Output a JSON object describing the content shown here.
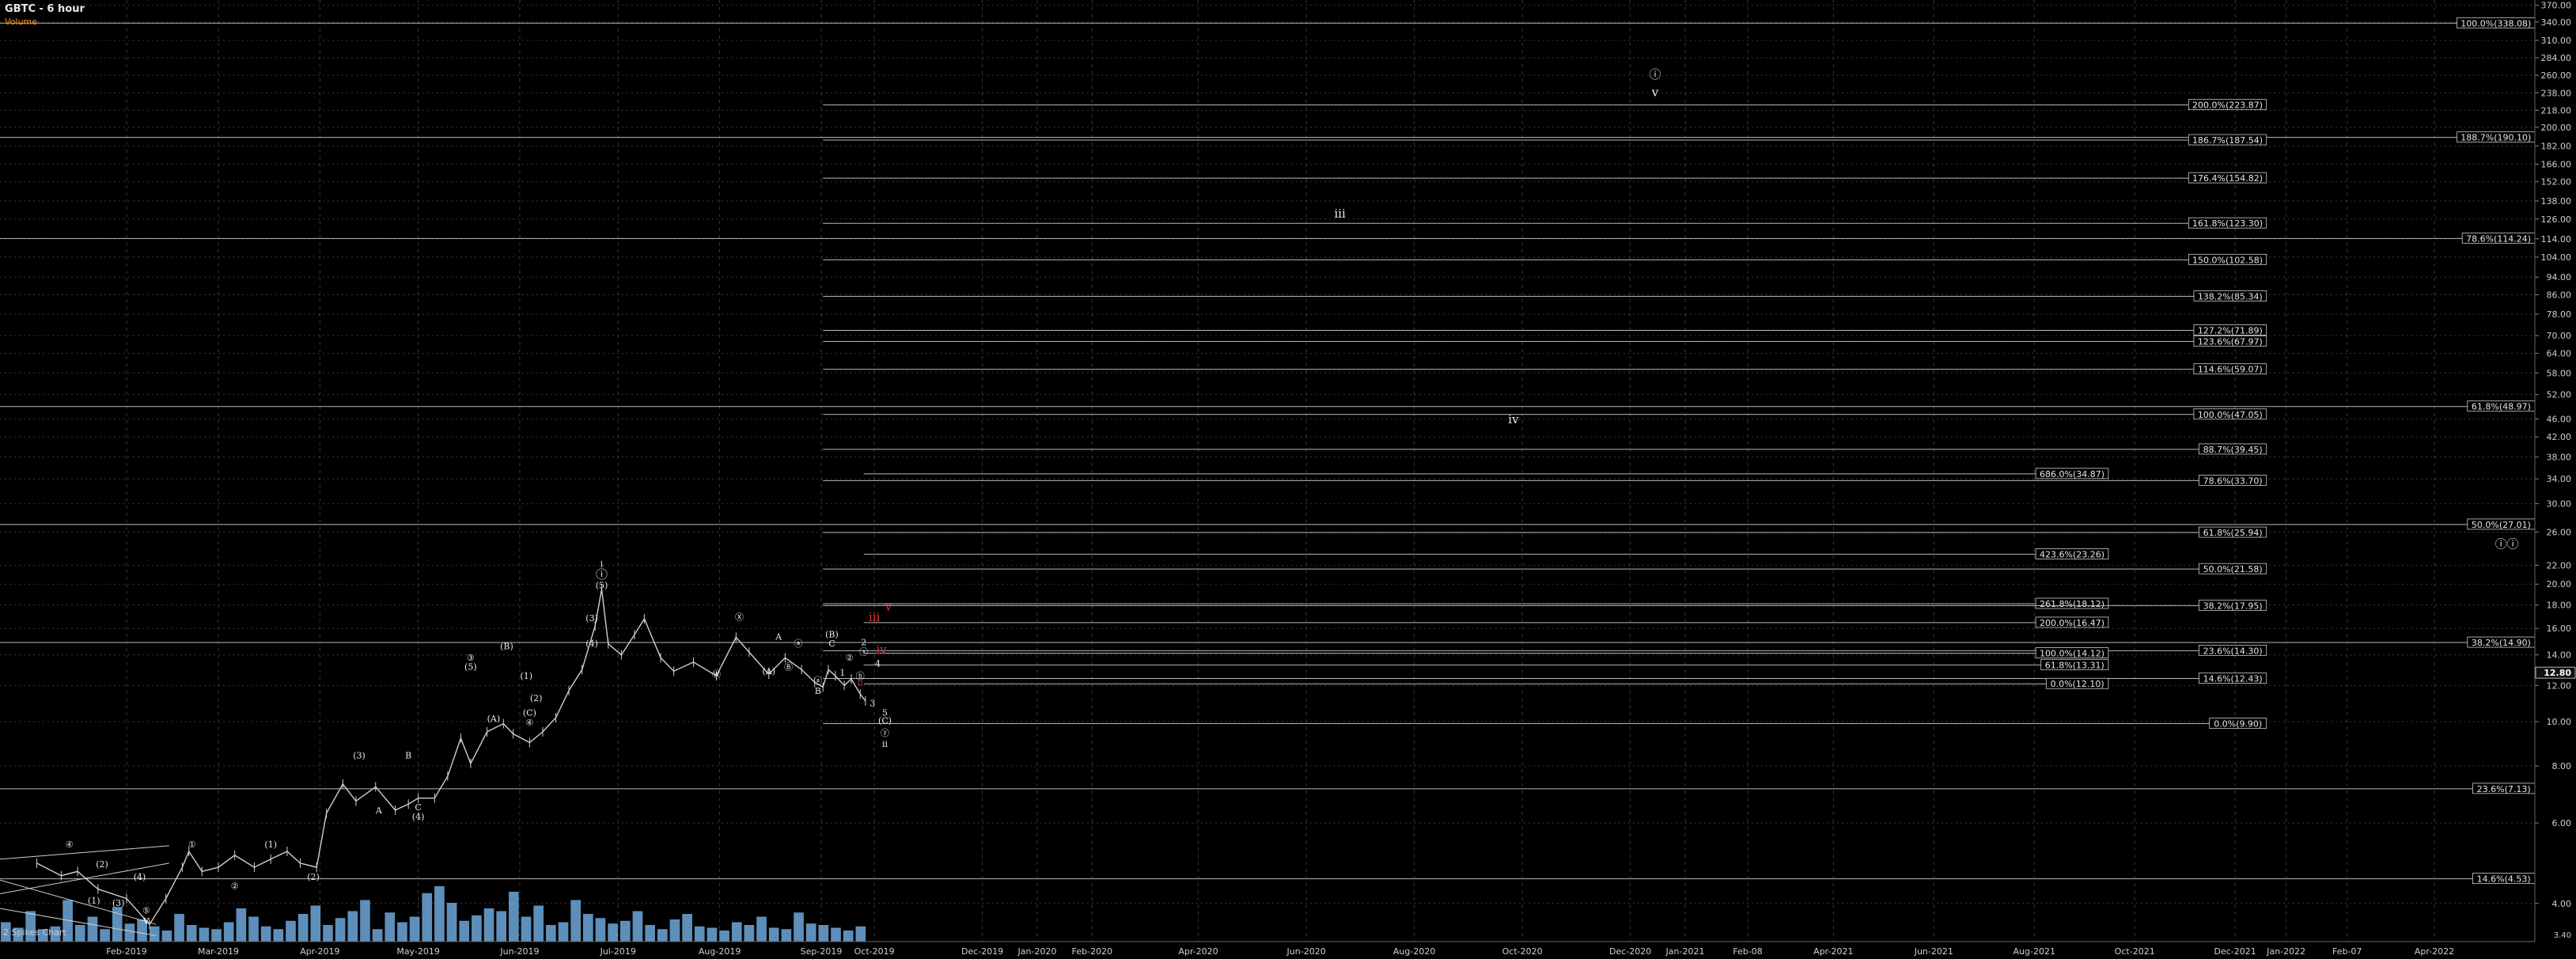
{
  "header": {
    "symbol": "GBTC - 6 hour",
    "volume_label": "Volume",
    "bottom_left": "2 Spikes Chart"
  },
  "colors": {
    "background": "#000000",
    "grid": "#3a3a3a",
    "fib": "#b8b8b8",
    "price_up": "#cfcfcf",
    "volume": "#6fa8dc",
    "red": "#e03030"
  },
  "chart_data": {
    "type": "line",
    "title": "GBTC - 6 hour",
    "y_scale": "log",
    "ylim": [
      3.3,
      380
    ],
    "grid": true,
    "y_ticks": [
      "370.00",
      "340.00",
      "310.00",
      "284.00",
      "260.00",
      "238.00",
      "218.00",
      "200.00",
      "182.00",
      "166.00",
      "152.00",
      "138.00",
      "126.00",
      "114.00",
      "104.00",
      "94.00",
      "86.00",
      "78.00",
      "70.00",
      "64.00",
      "58.00",
      "52.00",
      "46.00",
      "42.00",
      "38.00",
      "34.00",
      "30.00",
      "26.00",
      "22.00",
      "20.00",
      "18.00",
      "16.00",
      "14.00",
      "12.00",
      "10.00",
      "8.00",
      "6.00",
      "4.00"
    ],
    "x_ticks": [
      "Feb-2019",
      "Mar-2019",
      "Apr-2019",
      "May-2019",
      "Jun-2019",
      "Jul-2019",
      "Aug-2019",
      "Sep-2019",
      "Oct-2019",
      "Dec-2019",
      "Jan-2020",
      "Feb-2020",
      "Apr-2020",
      "Jun-2020",
      "Aug-2020",
      "Oct-2020",
      "Dec-2020",
      "Jan-2021",
      "Feb-08",
      "Apr-2021",
      "Jun-2021",
      "Aug-2021",
      "Oct-2021",
      "Dec-2021",
      "Jan-2022",
      "Feb-07",
      "Apr-2022"
    ],
    "current_price": "12.80",
    "bottom_right_label": "3.40",
    "series": [
      {
        "values": [
          [
            "2019-01-10",
            4.9
          ],
          [
            "2019-01-16",
            4.6
          ],
          [
            "2019-01-20",
            4.7
          ],
          [
            "2019-01-25",
            4.3
          ],
          [
            "2019-02-01",
            4.1
          ],
          [
            "2019-02-08",
            3.6
          ],
          [
            "2019-02-13",
            4.1
          ],
          [
            "2019-02-18",
            4.8
          ],
          [
            "2019-02-20",
            5.2
          ],
          [
            "2019-02-24",
            4.7
          ],
          [
            "2019-03-01",
            4.8
          ],
          [
            "2019-03-06",
            5.1
          ],
          [
            "2019-03-12",
            4.8
          ],
          [
            "2019-03-17",
            5.0
          ],
          [
            "2019-03-22",
            5.2
          ],
          [
            "2019-03-26",
            4.9
          ],
          [
            "2019-03-31",
            4.8
          ],
          [
            "2019-04-03",
            6.3
          ],
          [
            "2019-04-08",
            7.3
          ],
          [
            "2019-04-12",
            6.7
          ],
          [
            "2019-04-18",
            7.2
          ],
          [
            "2019-04-24",
            6.4
          ],
          [
            "2019-04-28",
            6.6
          ],
          [
            "2019-05-01",
            6.8
          ],
          [
            "2019-05-06",
            6.8
          ],
          [
            "2019-05-10",
            7.6
          ],
          [
            "2019-05-14",
            9.2
          ],
          [
            "2019-05-17",
            8.1
          ],
          [
            "2019-05-22",
            9.5
          ],
          [
            "2019-05-27",
            9.9
          ],
          [
            "2019-05-30",
            9.4
          ],
          [
            "2019-06-04",
            9.0
          ],
          [
            "2019-06-08",
            9.5
          ],
          [
            "2019-06-12",
            10.2
          ],
          [
            "2019-06-16",
            11.7
          ],
          [
            "2019-06-20",
            13.0
          ],
          [
            "2019-06-24",
            16.2
          ],
          [
            "2019-06-26",
            19.5
          ],
          [
            "2019-06-28",
            14.8
          ],
          [
            "2019-07-02",
            14.0
          ],
          [
            "2019-07-06",
            15.5
          ],
          [
            "2019-07-09",
            16.8
          ],
          [
            "2019-07-14",
            13.8
          ],
          [
            "2019-07-18",
            12.9
          ],
          [
            "2019-07-24",
            13.5
          ],
          [
            "2019-07-31",
            12.6
          ],
          [
            "2019-08-06",
            15.3
          ],
          [
            "2019-08-10",
            14.2
          ],
          [
            "2019-08-16",
            12.7
          ],
          [
            "2019-08-21",
            13.8
          ],
          [
            "2019-08-26",
            13.0
          ],
          [
            "2019-08-30",
            12.2
          ],
          [
            "2019-09-02",
            11.9
          ],
          [
            "2019-09-05",
            13.0
          ],
          [
            "2019-09-09",
            12.6
          ],
          [
            "2019-09-14",
            12.0
          ],
          [
            "2019-09-18",
            12.4
          ],
          [
            "2019-09-23",
            11.5
          ],
          [
            "2019-09-26",
            11.1
          ]
        ]
      }
    ],
    "volume": [
      14,
      10,
      22,
      9,
      11,
      30,
      12,
      18,
      9,
      25,
      13,
      16,
      11,
      8,
      20,
      12,
      10,
      9,
      14,
      24,
      18,
      11,
      9,
      15,
      20,
      26,
      12,
      17,
      22,
      30,
      9,
      21,
      14,
      18,
      35,
      40,
      28,
      15,
      19,
      24,
      22,
      36,
      18,
      26,
      12,
      14,
      30,
      20,
      17,
      13,
      15,
      22,
      12,
      9,
      16,
      20,
      11,
      10,
      8,
      14,
      12,
      18,
      10,
      9,
      21,
      13,
      12,
      10,
      8,
      11
    ],
    "fib_levels": [
      {
        "label": "100.0%(338.08)",
        "value": 338.08,
        "start": "2019-01-01",
        "end": "2022-06-01"
      },
      {
        "label": "200.0%(223.87)",
        "value": 223.87,
        "start": "2019-09-02",
        "end": "2021-12-20"
      },
      {
        "label": "188.7%(190.10)",
        "value": 190.1,
        "start": "2019-01-01",
        "end": "2022-06-01"
      },
      {
        "label": "186.7%(187.54)",
        "value": 187.54,
        "start": "2019-09-02",
        "end": "2021-12-20"
      },
      {
        "label": "176.4%(154.82)",
        "value": 154.82,
        "start": "2019-09-02",
        "end": "2021-12-20"
      },
      {
        "label": "161.8%(123.30)",
        "value": 123.3,
        "start": "2019-09-02",
        "end": "2021-12-20"
      },
      {
        "label": "78.6%(114.24)",
        "value": 114.24,
        "start": "2019-01-01",
        "end": "2022-06-01"
      },
      {
        "label": "150.0%(102.58)",
        "value": 102.58,
        "start": "2019-09-02",
        "end": "2021-12-20"
      },
      {
        "label": "138.2%(85.34)",
        "value": 85.34,
        "start": "2019-09-02",
        "end": "2021-12-20"
      },
      {
        "label": "127.2%(71.89)",
        "value": 71.89,
        "start": "2019-09-02",
        "end": "2021-12-20"
      },
      {
        "label": "123.6%(67.97)",
        "value": 67.97,
        "start": "2019-09-02",
        "end": "2021-12-20"
      },
      {
        "label": "114.6%(59.07)",
        "value": 59.07,
        "start": "2019-09-02",
        "end": "2021-12-20"
      },
      {
        "label": "61.8%(48.97)",
        "value": 48.97,
        "start": "2019-01-01",
        "end": "2022-06-01"
      },
      {
        "label": "100.0%(47.05)",
        "value": 47.05,
        "start": "2019-09-02",
        "end": "2021-12-20"
      },
      {
        "label": "88.7%(39.45)",
        "value": 39.45,
        "start": "2019-09-02",
        "end": "2021-12-20"
      },
      {
        "label": "686.0%(34.87)",
        "value": 34.87,
        "start": "2019-09-25",
        "end": "2021-09-15"
      },
      {
        "label": "78.6%(33.70)",
        "value": 33.7,
        "start": "2019-09-02",
        "end": "2021-12-20"
      },
      {
        "label": "50.0%(27.01)",
        "value": 27.01,
        "start": "2019-01-01",
        "end": "2022-06-01"
      },
      {
        "label": "61.8%(25.94)",
        "value": 25.94,
        "start": "2019-09-02",
        "end": "2021-12-20"
      },
      {
        "label": "423.6%(23.26)",
        "value": 23.26,
        "start": "2019-09-25",
        "end": "2021-09-15"
      },
      {
        "label": "50.0%(21.58)",
        "value": 21.58,
        "start": "2019-09-02",
        "end": "2021-12-20"
      },
      {
        "label": "261.8%(18.12)",
        "value": 18.12,
        "start": "2019-09-02",
        "end": "2021-09-15"
      },
      {
        "label": "38.2%(17.95)",
        "value": 17.95,
        "start": "2019-09-02",
        "end": "2021-12-20"
      },
      {
        "label": "200.0%(16.47)",
        "value": 16.47,
        "start": "2019-09-25",
        "end": "2021-09-15"
      },
      {
        "label": "38.2%(14.90)",
        "value": 14.9,
        "start": "2019-01-01",
        "end": "2022-06-01"
      },
      {
        "label": "23.6%(14.30)",
        "value": 14.3,
        "start": "2019-09-02",
        "end": "2021-12-20"
      },
      {
        "label": "100.0%(14.12)",
        "value": 14.12,
        "start": "2019-09-25",
        "end": "2021-09-15"
      },
      {
        "label": "61.8%(13.31)",
        "value": 13.31,
        "start": "2019-09-25",
        "end": "2021-09-15"
      },
      {
        "label": "14.6%(12.43)",
        "value": 12.43,
        "start": "2019-09-02",
        "end": "2021-12-20"
      },
      {
        "label": "0.0%(12.10)",
        "value": 12.1,
        "start": "2019-09-25",
        "end": "2021-09-15"
      },
      {
        "label": "0.0%(9.90)",
        "value": 9.9,
        "start": "2019-09-02",
        "end": "2021-12-20"
      },
      {
        "label": "23.6%(7.13)",
        "value": 7.13,
        "start": "2019-01-01",
        "end": "2022-06-01"
      },
      {
        "label": "14.6%(4.53)",
        "value": 4.53,
        "start": "2019-01-01",
        "end": "2022-06-01"
      }
    ],
    "annotations": [
      {
        "text": "ⓘ",
        "date": "2020-12-15",
        "value": 256,
        "color": "white"
      },
      {
        "text": "v",
        "date": "2020-12-15",
        "value": 234,
        "color": "white"
      },
      {
        "text": "iii",
        "date": "2020-06-20",
        "value": 127,
        "color": "white"
      },
      {
        "text": "iv",
        "date": "2020-09-26",
        "value": 45,
        "color": "white"
      },
      {
        "text": "ⓘⓘ",
        "date": "2022-05-15",
        "value": 24,
        "color": "white"
      },
      {
        "text": "i",
        "date": "2019-06-26",
        "value": 21.8,
        "color": "white"
      },
      {
        "text": "ⓘ",
        "date": "2019-06-26",
        "value": 20.6,
        "color": "white"
      },
      {
        "text": "(5)",
        "date": "2019-06-26",
        "value": 19.6,
        "color": "white"
      },
      {
        "text": "(3)",
        "date": "2019-06-23",
        "value": 16.6,
        "color": "white"
      },
      {
        "text": "(4)",
        "date": "2019-06-23",
        "value": 14.6,
        "color": "white"
      },
      {
        "text": "Ⓧ",
        "date": "2019-08-07",
        "value": 16.7,
        "color": "white"
      },
      {
        "text": "(B)",
        "date": "2019-05-28",
        "value": 14.4,
        "color": "white"
      },
      {
        "text": "③",
        "date": "2019-05-17",
        "value": 13.6,
        "color": "white"
      },
      {
        "text": "(5)",
        "date": "2019-05-17",
        "value": 13.0,
        "color": "white"
      },
      {
        "text": "(1)",
        "date": "2019-06-03",
        "value": 12.4,
        "color": "white"
      },
      {
        "text": "(2)",
        "date": "2019-06-06",
        "value": 11.1,
        "color": "white"
      },
      {
        "text": "(C)",
        "date": "2019-06-04",
        "value": 10.3,
        "color": "white"
      },
      {
        "text": "④",
        "date": "2019-06-04",
        "value": 9.8,
        "color": "white"
      },
      {
        "text": "(A)",
        "date": "2019-05-24",
        "value": 10.0,
        "color": "white"
      },
      {
        "text": "Ⓦ",
        "date": "2019-07-31",
        "value": 12.5,
        "color": "white"
      },
      {
        "text": "(A)",
        "date": "2019-08-16",
        "value": 12.7,
        "color": "white"
      },
      {
        "text": "Ⓑ",
        "date": "2019-08-22",
        "value": 13.0,
        "color": "white"
      },
      {
        "text": "A",
        "date": "2019-08-19",
        "value": 15.1,
        "color": "white"
      },
      {
        "text": "ⓐ",
        "date": "2019-08-25",
        "value": 14.6,
        "color": "white"
      },
      {
        "text": "(B)",
        "date": "2019-09-07",
        "value": 15.3,
        "color": "white"
      },
      {
        "text": "C",
        "date": "2019-09-07",
        "value": 14.6,
        "color": "white"
      },
      {
        "text": "ⓐ",
        "date": "2019-08-31",
        "value": 12.1,
        "color": "white"
      },
      {
        "text": "B",
        "date": "2019-08-31",
        "value": 11.5,
        "color": "white"
      },
      {
        "text": "1",
        "date": "2019-09-13",
        "value": 12.6,
        "color": "white"
      },
      {
        "text": "②",
        "date": "2019-09-17",
        "value": 13.6,
        "color": "white"
      },
      {
        "text": "2",
        "date": "2019-09-25",
        "value": 14.7,
        "color": "white"
      },
      {
        "text": "ⓢ",
        "date": "2019-09-25",
        "value": 14.0,
        "color": "white"
      },
      {
        "text": "4",
        "date": "2019-10-03",
        "value": 13.2,
        "color": "white"
      },
      {
        "text": "ⓑ",
        "date": "2019-09-23",
        "value": 12.4,
        "color": "white"
      },
      {
        "text": "3",
        "date": "2019-09-30",
        "value": 10.8,
        "color": "white"
      },
      {
        "text": "5",
        "date": "2019-10-07",
        "value": 10.3,
        "color": "white"
      },
      {
        "text": "(C)",
        "date": "2019-10-07",
        "value": 9.9,
        "color": "white"
      },
      {
        "text": "ⓨ",
        "date": "2019-10-07",
        "value": 9.3,
        "color": "white"
      },
      {
        "text": "ii",
        "date": "2019-10-07",
        "value": 8.8,
        "color": "white"
      },
      {
        "text": "v",
        "date": "2019-10-09",
        "value": 17.5,
        "color": "red"
      },
      {
        "text": "iii",
        "date": "2019-10-01",
        "value": 16.6,
        "color": "red"
      },
      {
        "text": "iv",
        "date": "2019-10-05",
        "value": 14.1,
        "color": "red"
      },
      {
        "text": "ii",
        "date": "2019-09-23",
        "value": 12.0,
        "color": "red"
      },
      {
        "text": "(3)",
        "date": "2019-04-13",
        "value": 8.3,
        "color": "white"
      },
      {
        "text": "B",
        "date": "2019-04-28",
        "value": 8.3,
        "color": "white"
      },
      {
        "text": "A",
        "date": "2019-04-19",
        "value": 6.3,
        "color": "white"
      },
      {
        "text": "C",
        "date": "2019-05-01",
        "value": 6.4,
        "color": "white"
      },
      {
        "text": "(4)",
        "date": "2019-05-01",
        "value": 6.1,
        "color": "white"
      },
      {
        "text": "(1)",
        "date": "2019-03-17",
        "value": 5.3,
        "color": "white"
      },
      {
        "text": "(2)",
        "date": "2019-03-30",
        "value": 4.5,
        "color": "white"
      },
      {
        "text": "①",
        "date": "2019-02-21",
        "value": 5.3,
        "color": "white"
      },
      {
        "text": "②",
        "date": "2019-03-06",
        "value": 4.3,
        "color": "white"
      },
      {
        "text": "④",
        "date": "2019-01-18",
        "value": 5.3,
        "color": "white"
      },
      {
        "text": "(2)",
        "date": "2019-01-26",
        "value": 4.8,
        "color": "white"
      },
      {
        "text": "(4)",
        "date": "2019-02-05",
        "value": 4.5,
        "color": "white"
      },
      {
        "text": "(1)",
        "date": "2019-01-24",
        "value": 4.0,
        "color": "white"
      },
      {
        "text": "(3)",
        "date": "2019-01-30",
        "value": 3.95,
        "color": "white"
      },
      {
        "text": "⑤",
        "date": "2019-02-07",
        "value": 3.8,
        "color": "white"
      },
      {
        "text": "v",
        "date": "2019-02-07",
        "value": 3.6,
        "color": "white"
      }
    ]
  }
}
